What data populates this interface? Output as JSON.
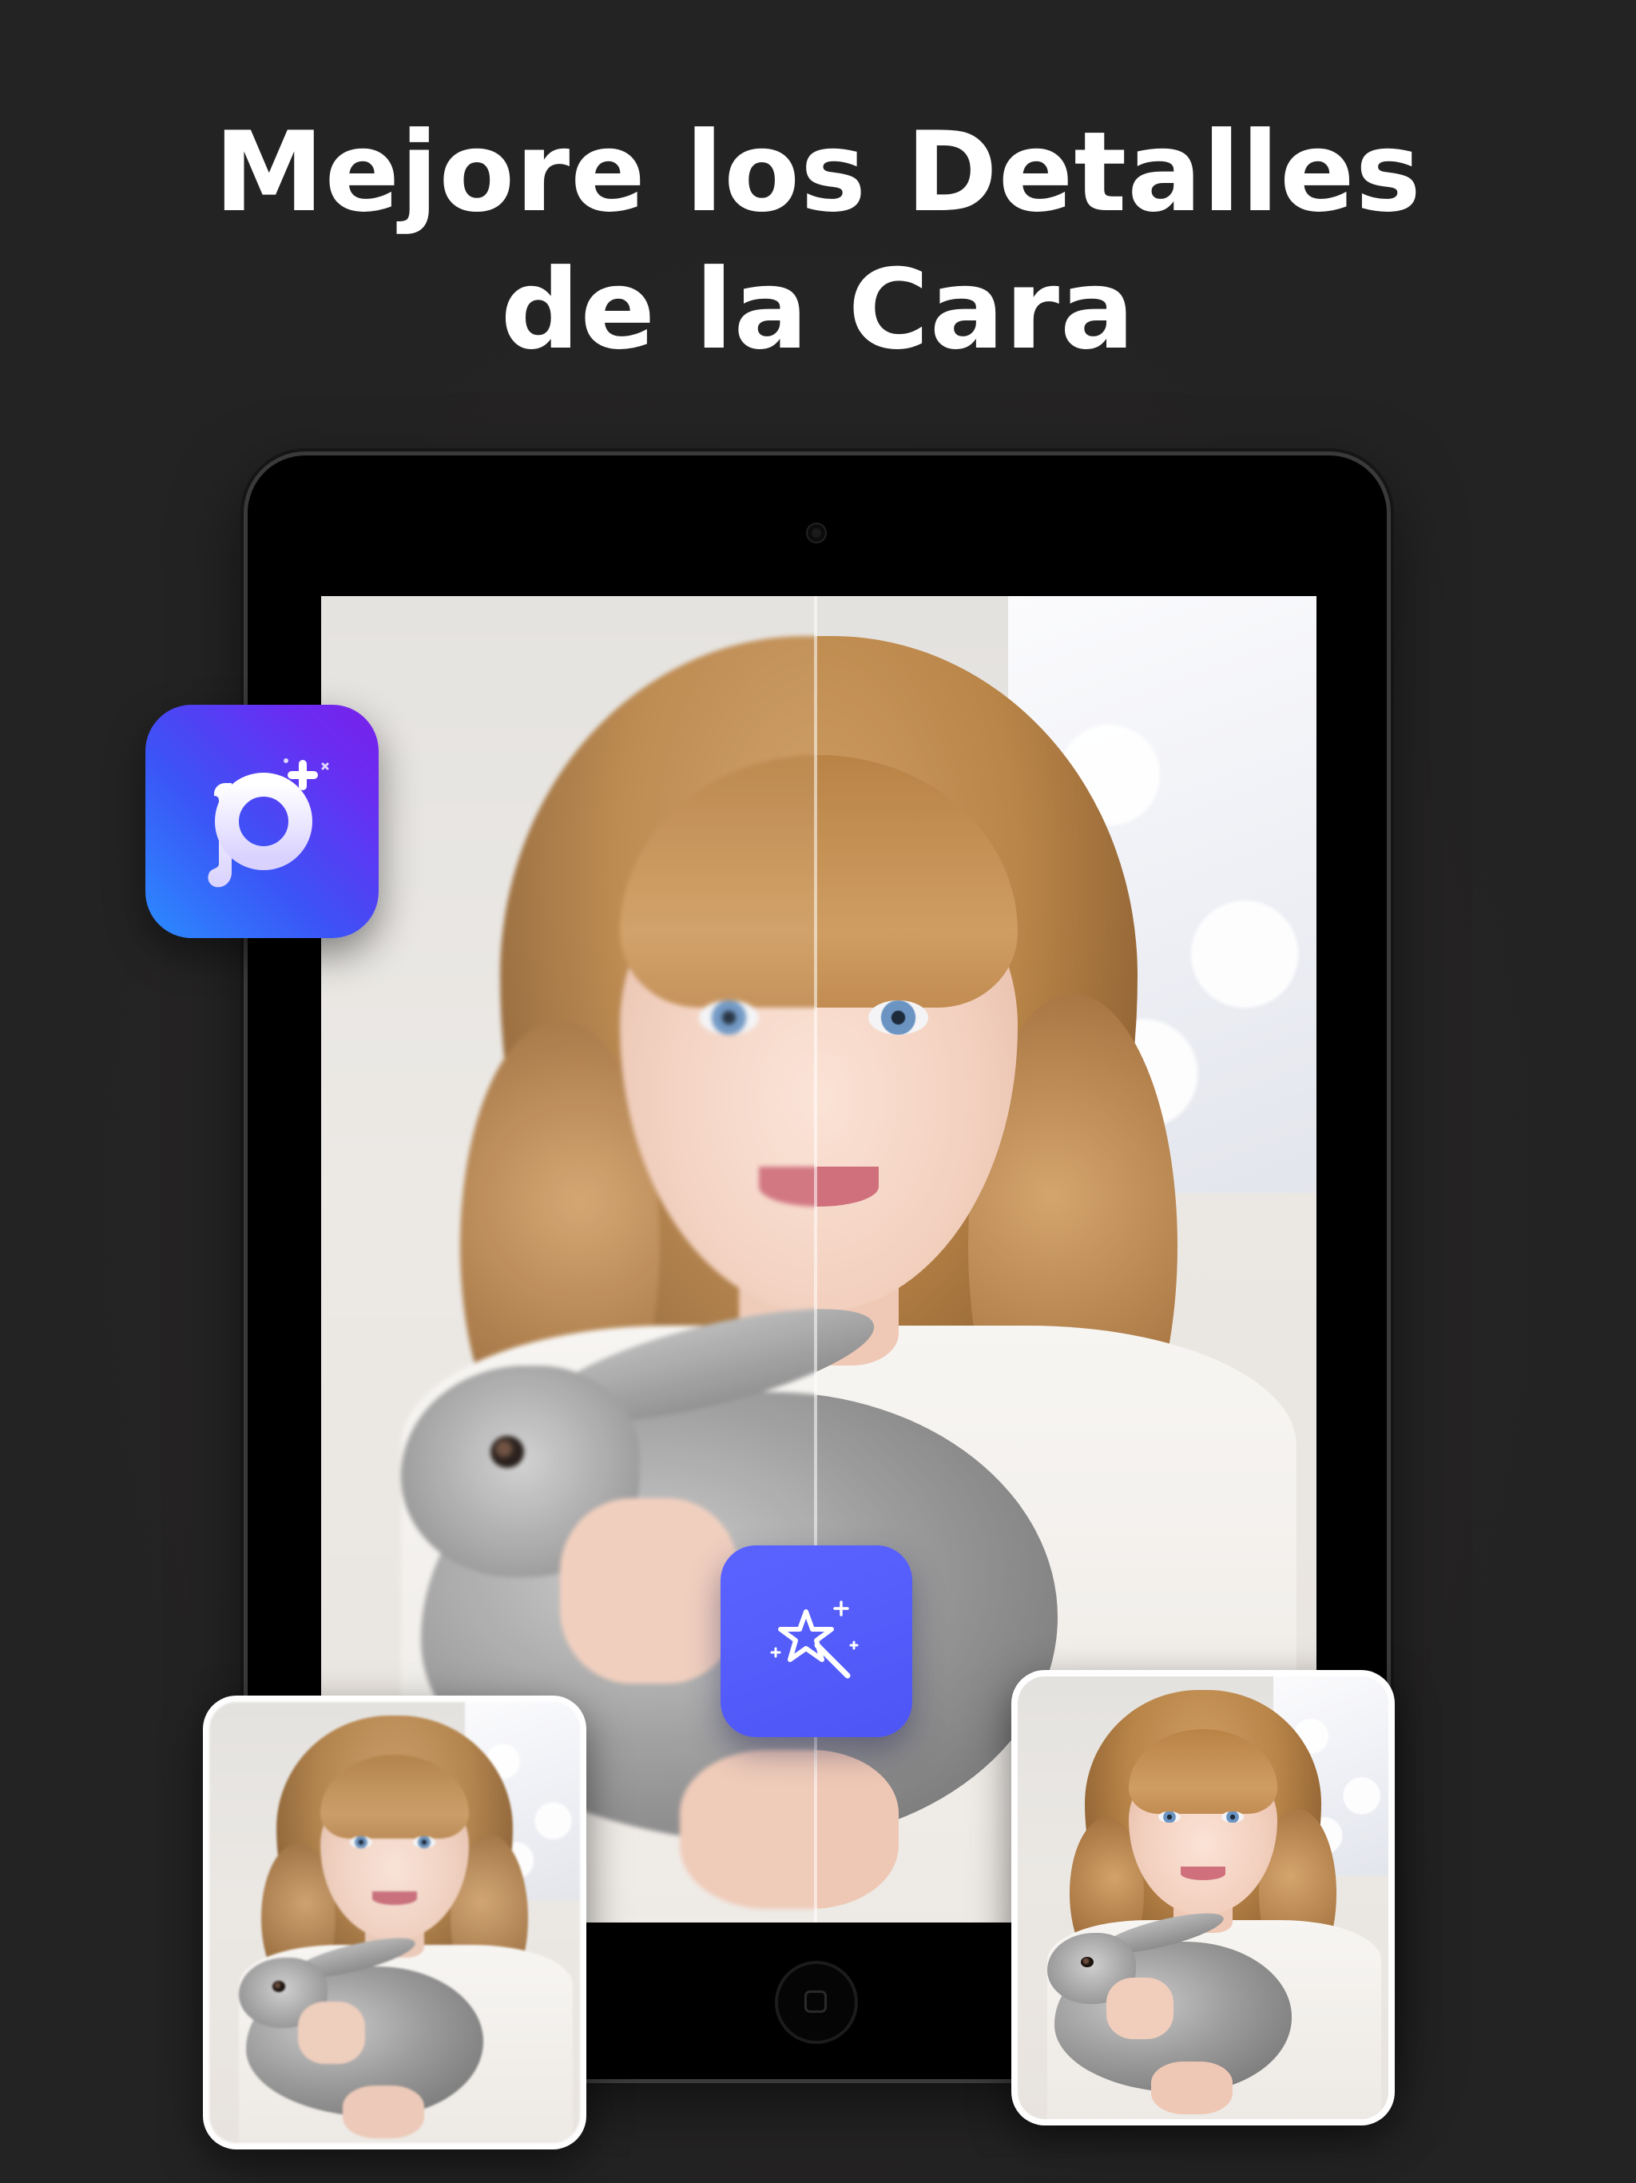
{
  "headline": {
    "line1": "Mejore los Detalles",
    "line2": "de la Cara"
  },
  "colors": {
    "background": "#262424",
    "headline_text": "#ffffff",
    "app_icon_gradient_start": "#2a8cff",
    "app_icon_gradient_end": "#7a21e8",
    "magic_button": "#5b63ff"
  },
  "icons": {
    "app_icon": "p-plus-sparkle-logo",
    "enhance_button": "magic-wand-star-icon"
  },
  "comparison": {
    "left": "before-blurry-photo",
    "right": "after-enhanced-photo"
  }
}
